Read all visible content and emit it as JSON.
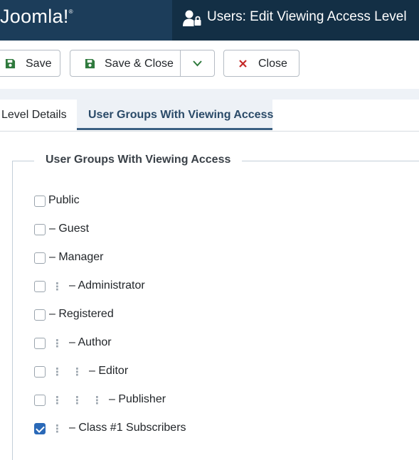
{
  "header": {
    "logo": "Joomla!",
    "title": "Users: Edit Viewing Access Level"
  },
  "toolbar": {
    "save_label": "Save",
    "save_close_label": "Save & Close",
    "close_label": "Close"
  },
  "tabs": [
    {
      "label": "Level Details",
      "active": false
    },
    {
      "label": "User Groups With Viewing Access",
      "active": true
    }
  ],
  "fieldset": {
    "legend": "User Groups With Viewing Access"
  },
  "groups": [
    {
      "label": "Public",
      "checked": false,
      "depth": 0
    },
    {
      "label": "– Guest",
      "checked": false,
      "depth": 0
    },
    {
      "label": "– Manager",
      "checked": false,
      "depth": 0
    },
    {
      "label": "– Administrator",
      "checked": false,
      "depth": 1
    },
    {
      "label": "– Registered",
      "checked": false,
      "depth": 0
    },
    {
      "label": "– Author",
      "checked": false,
      "depth": 1
    },
    {
      "label": "– Editor",
      "checked": false,
      "depth": 2
    },
    {
      "label": "– Publisher",
      "checked": false,
      "depth": 3
    },
    {
      "label": "– Class #1 Subscribers",
      "checked": true,
      "depth": 1
    }
  ],
  "colors": {
    "header_bg": "#1c3d5a",
    "title_bg": "#132f45",
    "save_icon": "#2f7a3d",
    "close_icon": "#c52827",
    "checkbox_checked": "#2a69b8",
    "active_tab": "#2a4a68"
  },
  "icons": {
    "title": "user-lock-icon",
    "save": "save-icon",
    "save_close": "save-icon",
    "dropdown": "chevron-down-icon",
    "close": "close-icon"
  }
}
